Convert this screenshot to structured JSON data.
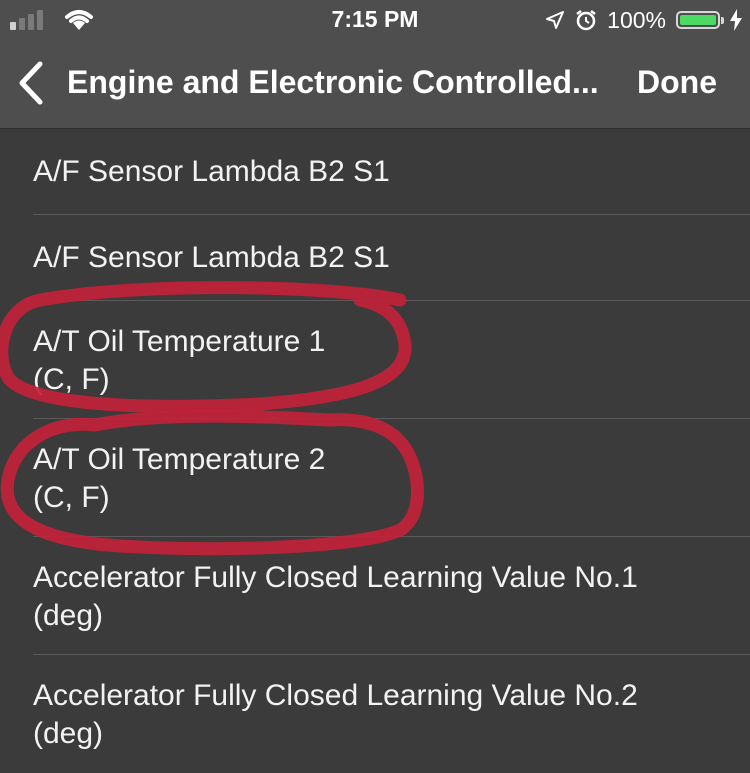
{
  "status_bar": {
    "time": "7:15 PM",
    "battery_percent": "100%"
  },
  "nav": {
    "title": "Engine and Electronic Controlled...",
    "done_label": "Done"
  },
  "items": [
    {
      "label": "A/F Sensor Lambda B2 S1"
    },
    {
      "label": "A/F Sensor Lambda B2 S1"
    },
    {
      "label": "A/T Oil Temperature 1",
      "unit": "(C, F)"
    },
    {
      "label": "A/T Oil Temperature 2",
      "unit": "(C, F)"
    },
    {
      "label": "Accelerator Fully Closed Learning Value No.1",
      "unit": "(deg)"
    },
    {
      "label": "Accelerator Fully Closed Learning Value No.2",
      "unit": "(deg)"
    }
  ],
  "colors": {
    "background": "#3b3b3b",
    "bar": "#4e4e4e",
    "battery": "#4cd964",
    "annotation": "#c2223a"
  }
}
